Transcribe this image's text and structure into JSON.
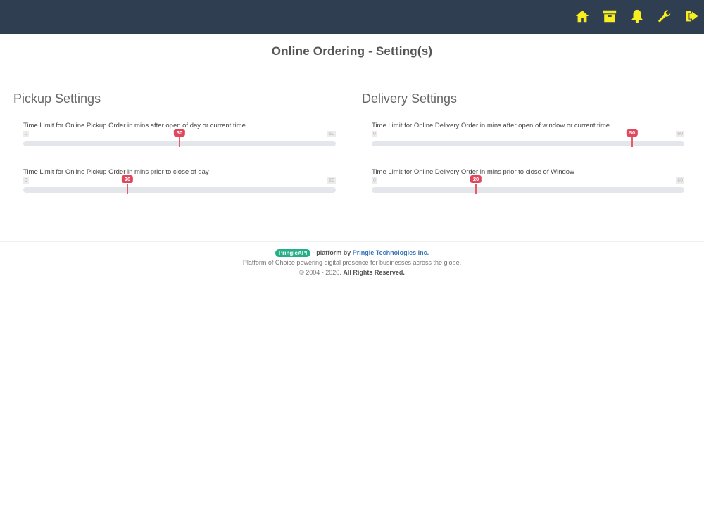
{
  "header": {
    "icons": [
      "home-icon",
      "archive-icon",
      "bell-icon",
      "wrench-icon",
      "logout-icon"
    ],
    "icon_color": "#f6ee1f",
    "bg_color": "#2f3e50"
  },
  "page": {
    "title": "Online Ordering - Setting(s)"
  },
  "pickup": {
    "title": "Pickup Settings",
    "settings": [
      {
        "label": "Time Limit for Online Pickup Order in mins after open of day or current time",
        "min": "0",
        "max": "60",
        "value": "30"
      },
      {
        "label": "Time Limit for Online Pickup Order in mins prior to close of day",
        "min": "0",
        "max": "60",
        "value": "20"
      }
    ]
  },
  "delivery": {
    "title": "Delivery Settings",
    "settings": [
      {
        "label": "Time Limit for Online Delivery Order in mins after open of window or current time",
        "min": "0",
        "max": "60",
        "value": "50"
      },
      {
        "label": "Time Limit for Online Delivery Order in mins prior to close of Window",
        "min": "0",
        "max": "60",
        "value": "20"
      }
    ]
  },
  "footer": {
    "brand": "PringleAPI",
    "platform_by": " - platform by ",
    "company": "Pringle Technologies Inc.",
    "tagline": "Platform of Choice powering digital presence for businesses across the globe.",
    "copyright": "© 2004 - 2020.",
    "rights": "All Rights Reserved."
  },
  "colors": {
    "accent": "#e0485d",
    "brand_badge": "#27ae87",
    "link": "#3a73b8"
  }
}
